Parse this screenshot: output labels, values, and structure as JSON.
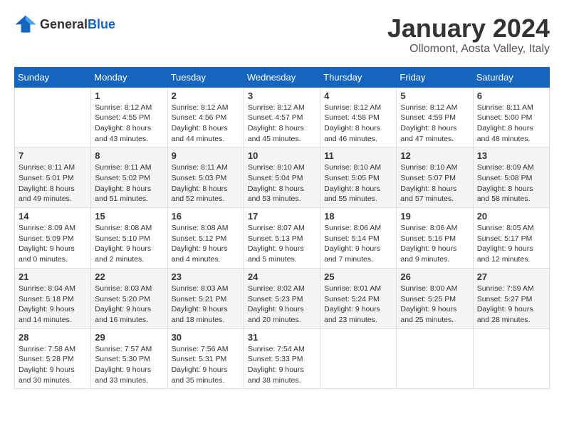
{
  "logo": {
    "general": "General",
    "blue": "Blue"
  },
  "title": {
    "month_year": "January 2024",
    "location": "Ollomont, Aosta Valley, Italy"
  },
  "weekdays": [
    "Sunday",
    "Monday",
    "Tuesday",
    "Wednesday",
    "Thursday",
    "Friday",
    "Saturday"
  ],
  "weeks": [
    [
      {
        "day": "",
        "info": ""
      },
      {
        "day": "1",
        "info": "Sunrise: 8:12 AM\nSunset: 4:55 PM\nDaylight: 8 hours\nand 43 minutes."
      },
      {
        "day": "2",
        "info": "Sunrise: 8:12 AM\nSunset: 4:56 PM\nDaylight: 8 hours\nand 44 minutes."
      },
      {
        "day": "3",
        "info": "Sunrise: 8:12 AM\nSunset: 4:57 PM\nDaylight: 8 hours\nand 45 minutes."
      },
      {
        "day": "4",
        "info": "Sunrise: 8:12 AM\nSunset: 4:58 PM\nDaylight: 8 hours\nand 46 minutes."
      },
      {
        "day": "5",
        "info": "Sunrise: 8:12 AM\nSunset: 4:59 PM\nDaylight: 8 hours\nand 47 minutes."
      },
      {
        "day": "6",
        "info": "Sunrise: 8:11 AM\nSunset: 5:00 PM\nDaylight: 8 hours\nand 48 minutes."
      }
    ],
    [
      {
        "day": "7",
        "info": "Sunrise: 8:11 AM\nSunset: 5:01 PM\nDaylight: 8 hours\nand 49 minutes."
      },
      {
        "day": "8",
        "info": "Sunrise: 8:11 AM\nSunset: 5:02 PM\nDaylight: 8 hours\nand 51 minutes."
      },
      {
        "day": "9",
        "info": "Sunrise: 8:11 AM\nSunset: 5:03 PM\nDaylight: 8 hours\nand 52 minutes."
      },
      {
        "day": "10",
        "info": "Sunrise: 8:10 AM\nSunset: 5:04 PM\nDaylight: 8 hours\nand 53 minutes."
      },
      {
        "day": "11",
        "info": "Sunrise: 8:10 AM\nSunset: 5:05 PM\nDaylight: 8 hours\nand 55 minutes."
      },
      {
        "day": "12",
        "info": "Sunrise: 8:10 AM\nSunset: 5:07 PM\nDaylight: 8 hours\nand 57 minutes."
      },
      {
        "day": "13",
        "info": "Sunrise: 8:09 AM\nSunset: 5:08 PM\nDaylight: 8 hours\nand 58 minutes."
      }
    ],
    [
      {
        "day": "14",
        "info": "Sunrise: 8:09 AM\nSunset: 5:09 PM\nDaylight: 9 hours\nand 0 minutes."
      },
      {
        "day": "15",
        "info": "Sunrise: 8:08 AM\nSunset: 5:10 PM\nDaylight: 9 hours\nand 2 minutes."
      },
      {
        "day": "16",
        "info": "Sunrise: 8:08 AM\nSunset: 5:12 PM\nDaylight: 9 hours\nand 4 minutes."
      },
      {
        "day": "17",
        "info": "Sunrise: 8:07 AM\nSunset: 5:13 PM\nDaylight: 9 hours\nand 5 minutes."
      },
      {
        "day": "18",
        "info": "Sunrise: 8:06 AM\nSunset: 5:14 PM\nDaylight: 9 hours\nand 7 minutes."
      },
      {
        "day": "19",
        "info": "Sunrise: 8:06 AM\nSunset: 5:16 PM\nDaylight: 9 hours\nand 9 minutes."
      },
      {
        "day": "20",
        "info": "Sunrise: 8:05 AM\nSunset: 5:17 PM\nDaylight: 9 hours\nand 12 minutes."
      }
    ],
    [
      {
        "day": "21",
        "info": "Sunrise: 8:04 AM\nSunset: 5:18 PM\nDaylight: 9 hours\nand 14 minutes."
      },
      {
        "day": "22",
        "info": "Sunrise: 8:03 AM\nSunset: 5:20 PM\nDaylight: 9 hours\nand 16 minutes."
      },
      {
        "day": "23",
        "info": "Sunrise: 8:03 AM\nSunset: 5:21 PM\nDaylight: 9 hours\nand 18 minutes."
      },
      {
        "day": "24",
        "info": "Sunrise: 8:02 AM\nSunset: 5:23 PM\nDaylight: 9 hours\nand 20 minutes."
      },
      {
        "day": "25",
        "info": "Sunrise: 8:01 AM\nSunset: 5:24 PM\nDaylight: 9 hours\nand 23 minutes."
      },
      {
        "day": "26",
        "info": "Sunrise: 8:00 AM\nSunset: 5:25 PM\nDaylight: 9 hours\nand 25 minutes."
      },
      {
        "day": "27",
        "info": "Sunrise: 7:59 AM\nSunset: 5:27 PM\nDaylight: 9 hours\nand 28 minutes."
      }
    ],
    [
      {
        "day": "28",
        "info": "Sunrise: 7:58 AM\nSunset: 5:28 PM\nDaylight: 9 hours\nand 30 minutes."
      },
      {
        "day": "29",
        "info": "Sunrise: 7:57 AM\nSunset: 5:30 PM\nDaylight: 9 hours\nand 33 minutes."
      },
      {
        "day": "30",
        "info": "Sunrise: 7:56 AM\nSunset: 5:31 PM\nDaylight: 9 hours\nand 35 minutes."
      },
      {
        "day": "31",
        "info": "Sunrise: 7:54 AM\nSunset: 5:33 PM\nDaylight: 9 hours\nand 38 minutes."
      },
      {
        "day": "",
        "info": ""
      },
      {
        "day": "",
        "info": ""
      },
      {
        "day": "",
        "info": ""
      }
    ]
  ]
}
